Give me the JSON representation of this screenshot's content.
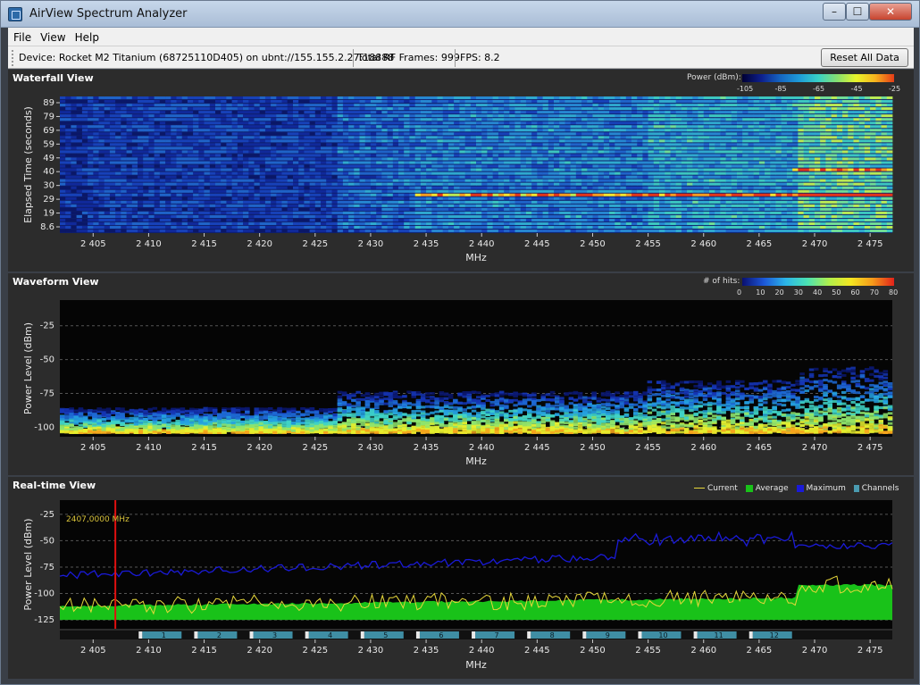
{
  "window": {
    "title": "AirView Spectrum Analyzer"
  },
  "menu": [
    "File",
    "View",
    "Help"
  ],
  "toolbar": {
    "device": "Device: Rocket M2 Titanium (68725110D405) on ubnt://155.155.2.27:18888",
    "frames": "Total RF Frames: 999",
    "fps": "FPS: 8.2",
    "reset_label": "Reset All Data"
  },
  "x_axis": {
    "label": "MHz",
    "ticks": [
      "2 405",
      "2 410",
      "2 415",
      "2 420",
      "2 425",
      "2 430",
      "2 435",
      "2 440",
      "2 445",
      "2 450",
      "2 455",
      "2 460",
      "2 465",
      "2 470",
      "2 475"
    ],
    "tick_values": [
      2405,
      2410,
      2415,
      2420,
      2425,
      2430,
      2435,
      2440,
      2445,
      2450,
      2455,
      2460,
      2465,
      2470,
      2475
    ],
    "range": [
      2402,
      2477
    ]
  },
  "waterfall": {
    "title": "Waterfall View",
    "legend_label": "Power (dBm):",
    "legend_ticks": [
      "-105",
      "-85",
      "-65",
      "-45",
      "-25"
    ],
    "y_label": "Elapsed Time (seconds)",
    "y_ticks": [
      "89",
      "79",
      "69",
      "59",
      "49",
      "40",
      "30",
      "29",
      "19",
      "8.6"
    ]
  },
  "waveform": {
    "title": "Waveform View",
    "legend_label": "# of hits:",
    "legend_ticks": [
      "0",
      "10",
      "20",
      "30",
      "40",
      "50",
      "60",
      "70",
      "80"
    ],
    "y_label": "Power Level (dBm)",
    "y_ticks": [
      "-25",
      "-50",
      "-75",
      "-100"
    ]
  },
  "realtime": {
    "title": "Real-time View",
    "legend": [
      {
        "name": "Current",
        "color": "#e8d83a"
      },
      {
        "name": "Average",
        "color": "#19c219"
      },
      {
        "name": "Maximum",
        "color": "#1a1ad8"
      },
      {
        "name": "Channels",
        "color": "#4a9bb0"
      }
    ],
    "y_label": "Power Level (dBm)",
    "y_ticks": [
      "-25",
      "-50",
      "-75",
      "-100",
      "-125"
    ],
    "y_tick_values": [
      -25,
      -50,
      -75,
      -100,
      -125
    ],
    "marker_label": "2407,0000 MHz",
    "marker_mhz": 2407,
    "channels": [
      "1",
      "2",
      "3",
      "4",
      "5",
      "6",
      "7",
      "8",
      "9",
      "10",
      "11",
      "12"
    ],
    "channel_centers_mhz": [
      2412,
      2417,
      2422,
      2427,
      2432,
      2437,
      2442,
      2447,
      2452,
      2457,
      2462,
      2467
    ]
  },
  "colors": {
    "current": "#e8d83a",
    "average": "#19c219",
    "maximum": "#1a1ad8",
    "marker": "#e01010"
  }
}
